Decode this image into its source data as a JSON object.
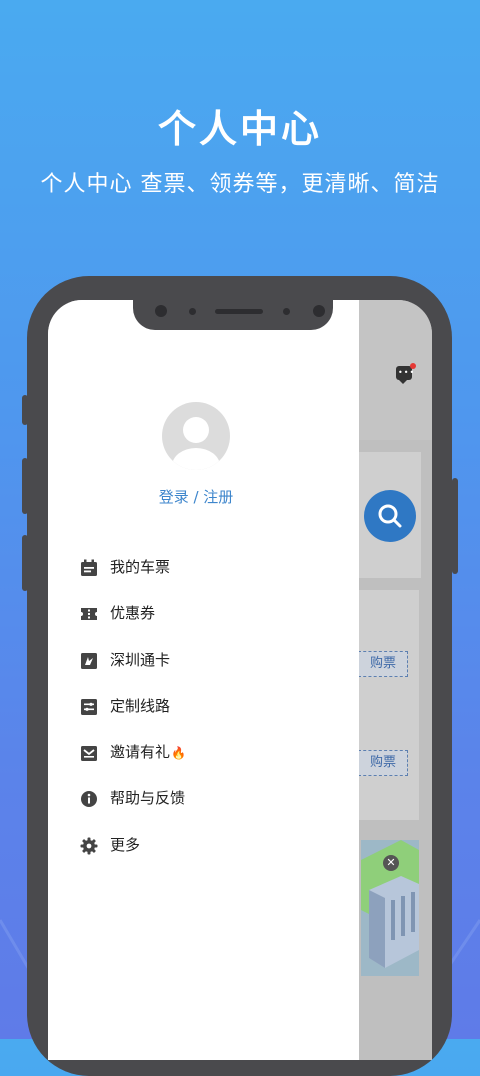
{
  "promo": {
    "title": "个人中心",
    "subtitle": "个人中心 查票、领券等，更清晰、简洁"
  },
  "drawer": {
    "login_label": "登录 / 注册",
    "menu": [
      {
        "label": "我的车票",
        "icon": "calendar-icon"
      },
      {
        "label": "优惠券",
        "icon": "coupon-icon"
      },
      {
        "label": "深圳通卡",
        "icon": "transit-card-icon"
      },
      {
        "label": "定制线路",
        "icon": "route-icon"
      },
      {
        "label": "邀请有礼",
        "icon": "gift-box-icon",
        "badge": "🔥"
      },
      {
        "label": "帮助与反馈",
        "icon": "info-icon"
      },
      {
        "label": "更多",
        "icon": "gear-icon"
      }
    ]
  },
  "background_app": {
    "buy_label_1": "购票",
    "buy_label_2": "购票",
    "ad_close": "✕"
  },
  "colors": {
    "accent": "#3e86cc",
    "phone_frame": "#4a4a4d",
    "badge_red": "#e53935"
  }
}
